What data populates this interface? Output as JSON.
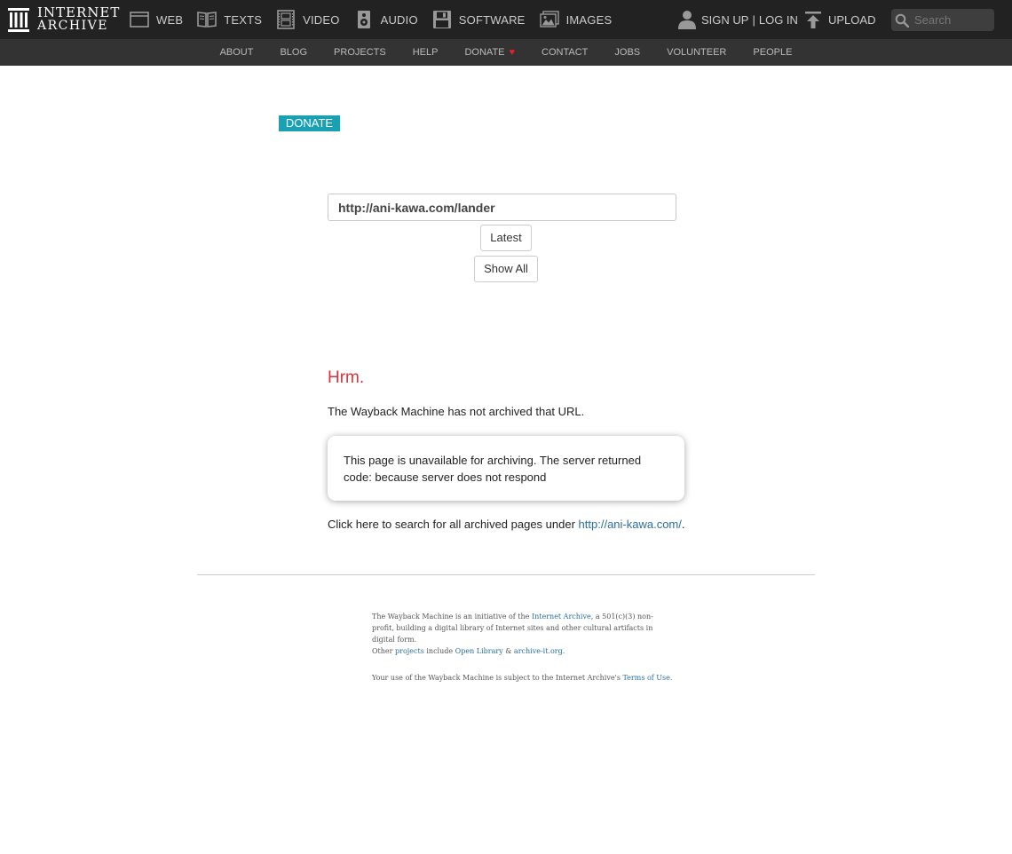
{
  "header": {
    "logo": {
      "line1": "INTERNET",
      "line2": "ARCHIVE",
      "icon": "archive-building-icon"
    },
    "media_nav": [
      {
        "label": "WEB",
        "icon": "web-icon"
      },
      {
        "label": "TEXTS",
        "icon": "book-icon"
      },
      {
        "label": "VIDEO",
        "icon": "film-icon"
      },
      {
        "label": "AUDIO",
        "icon": "speaker-icon"
      },
      {
        "label": "SOFTWARE",
        "icon": "floppy-icon"
      },
      {
        "label": "IMAGES",
        "icon": "image-icon"
      }
    ],
    "user": {
      "signup": "SIGN UP",
      "separator": "|",
      "login": "LOG IN",
      "icon": "user-icon"
    },
    "upload": {
      "label": "UPLOAD",
      "icon": "upload-icon"
    },
    "search": {
      "placeholder": "Search",
      "icon": "search-icon"
    }
  },
  "subnav": {
    "items": [
      "ABOUT",
      "BLOG",
      "PROJECTS",
      "HELP",
      "DONATE",
      "CONTACT",
      "JOBS",
      "VOLUNTEER",
      "PEOPLE"
    ],
    "donate_heart": "♥"
  },
  "main": {
    "donate_button": "DONATE",
    "url_value": "http://ani-kawa.com/lander",
    "latest_button": "Latest",
    "show_all_button": "Show All",
    "heading": "Hrm.",
    "not_archived": "The Wayback Machine has not archived that URL.",
    "error_message": "This page is unavailable for archiving. The server returned code: because server does not respond",
    "search_under_prefix": "Click here to search for all archived pages under ",
    "search_under_link": "http://ani-kawa.com/",
    "search_under_suffix": "."
  },
  "footer": {
    "p1_a": "The Wayback Machine is an initiative of the ",
    "p1_link": "Internet Archive",
    "p1_b": ", a 501(c)(3) non-profit, building a digital library of Internet sites and other cultural artifacts in digital form.",
    "p1_other": "Other ",
    "p1_projects": "projects",
    "p1_include": " include ",
    "p1_openlibrary": "Open Library",
    "p1_amp": " & ",
    "p1_archiveit": "archive-it.org",
    "p1_end": ".",
    "p2_a": "Your use of the Wayback Machine is subject to the Internet Archive's ",
    "p2_link": "Terms of Use",
    "p2_end": "."
  },
  "colors": {
    "topbar": "#222222",
    "subnav": "#333333",
    "donate_accent": "#19a0b3",
    "heading_red": "#d6343d",
    "link_blue": "#2a6fa0"
  }
}
